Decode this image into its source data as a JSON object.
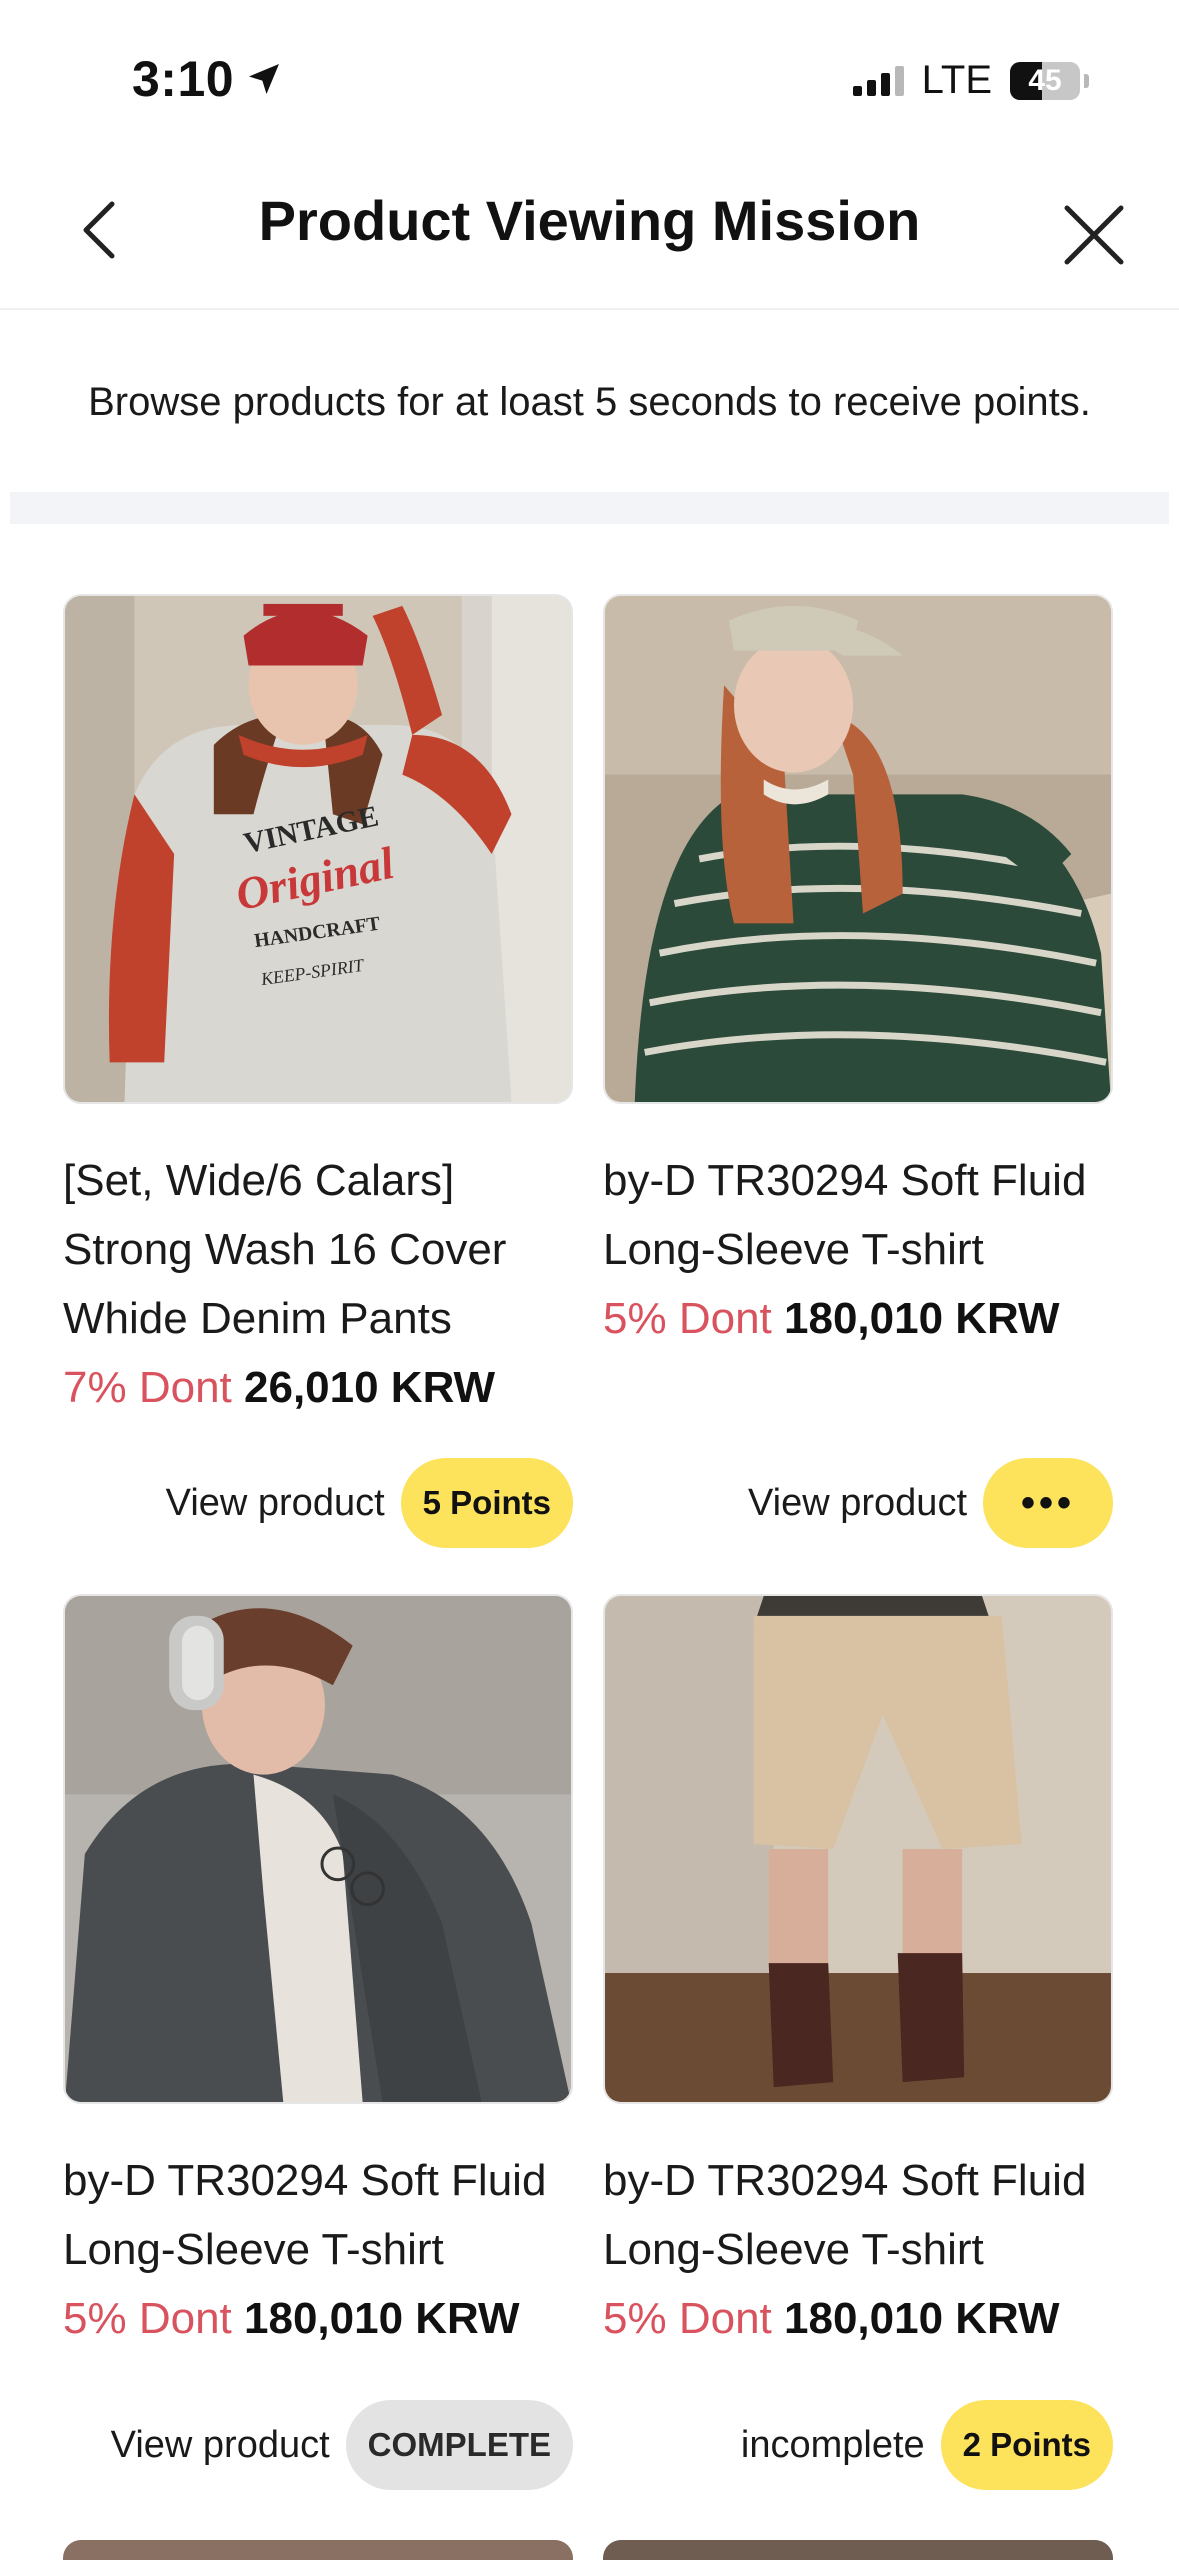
{
  "status_bar": {
    "time": "3:10",
    "network": "LTE",
    "battery": "45",
    "battery_level": 0.45
  },
  "nav": {
    "title": "Product Viewing Mission"
  },
  "notice": "Browse products for at loast 5 seconds to receive points.",
  "products": [
    {
      "name": "[Set, Wide/6 Calars] Strong Wash 16 Cover Whide Denim Pants",
      "discount": "7% Dont",
      "price": "26,010 KRW",
      "action_label": "View product",
      "badge": "5 Points",
      "image_text": [
        "VINTAGE",
        "Original",
        "HANDCRAFT",
        "KEEP-SPIRIT"
      ]
    },
    {
      "name": "by-D TR30294 Soft Fluid Long-Sleeve T-shirt",
      "discount": "5% Dont",
      "price": "180,010 KRW",
      "action_label": "View product",
      "badge": "•••"
    },
    {
      "name": "by-D TR30294 Soft Fluid Long-Sleeve T-shirt",
      "discount": "5% Dont",
      "price": "180,010 KRW",
      "action_label": "View product",
      "badge": "COMPLETE"
    },
    {
      "name": "by-D TR30294 Soft Fluid Long-Sleeve T-shirt",
      "discount": "5% Dont",
      "price": "180,010 KRW",
      "action_label": "incomplete",
      "badge": "2 Points"
    }
  ],
  "colors": {
    "discount": "#d9535f",
    "badge_yellow": "#fde25c",
    "badge_gray": "#e3e3e3"
  }
}
